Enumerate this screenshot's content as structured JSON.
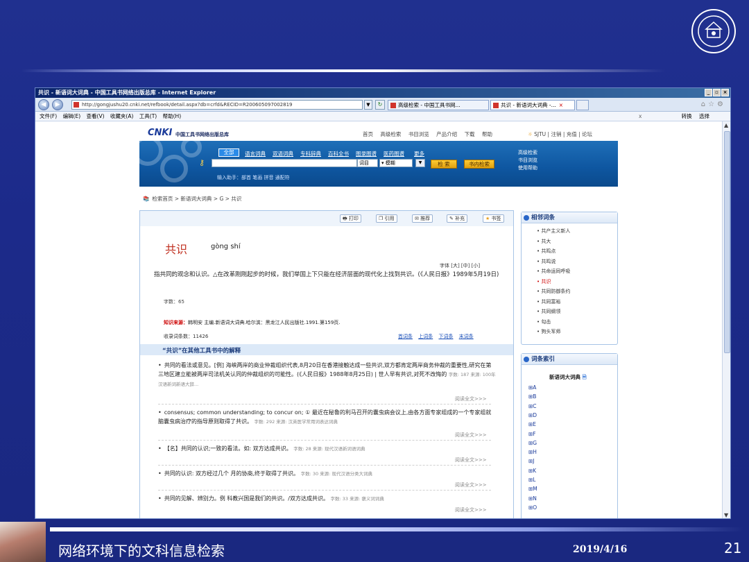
{
  "slide": {
    "footer_title": "网络环境下的文科信息检索",
    "footer_date": "2019/4/16",
    "page_number": "21",
    "logo_icon": "university-seal-icon"
  },
  "browser": {
    "window_title": "共识 - 新语词大词典 - 中国工具书网络出版总库 - Internet Explorer",
    "address": "http://gongjushu20.cnki.net/refbook/detail.aspx?db=crfd&RECID=R200605097002819",
    "tabs": [
      {
        "label": "高级检索 - 中国工具书网..."
      },
      {
        "label": "共识 - 新语词大词典 -...",
        "close": "×"
      }
    ],
    "menu": [
      "文件(F)",
      "编辑(E)",
      "查看(V)",
      "收藏夹(A)",
      "工具(T)",
      "帮助(H)"
    ],
    "menu_right": [
      "转换",
      "选择"
    ],
    "menu_close": "x",
    "window_buttons": [
      "_",
      "▫",
      "×"
    ]
  },
  "cnki": {
    "logo": "CNKI",
    "logo_cn": "中国工具书网络出版总库",
    "topnav": [
      "首页",
      "高级检索",
      "书目浏览",
      "产品介绍",
      "下载",
      "帮助"
    ],
    "user": "SJTU | 注销 | 充值 | 论坛",
    "categories": [
      "全部",
      "语言词典",
      "双语词典",
      "专科辞典",
      "百科全书",
      "图录图谱",
      "医药图谱",
      "更多"
    ],
    "field_select": "词目",
    "mode_select": "模糊",
    "search_button": "检 索",
    "book_search_button": "书内检索",
    "helper": "输入助手：部首 笔画 拼音 通配符",
    "right_links": [
      "高级检索",
      "书目浏览",
      "使用帮助"
    ],
    "breadcrumb": "检索首页 > 新语词大词典 > G > 共识"
  },
  "toolbar": [
    "打印",
    "引用",
    "推荐",
    "补充",
    "书签"
  ],
  "entry": {
    "headword": "共识",
    "pinyin": "gòng shí",
    "font_size": "字体 [大] [中] [小]",
    "definition": "指共同的观念和认识。△在改革刚刚起步的时候，我们举国上下只能在经济层面的现代化上找到共识。(《人民日报》1989年5月19日)",
    "wordcount": "字数：65",
    "source_label": "知识来源：",
    "source_text": "韩明安 主编.新语词大词典.哈尔滨：黑龙江人民出版社.1991.第159页.",
    "entrycount": "收录词条数：11426",
    "nav_links": [
      "首词条",
      "上词条",
      "下词条",
      "末词条"
    ]
  },
  "other": {
    "title": "“共识”在其他工具书中的解释",
    "read_more": "阅读全文>>>",
    "items": [
      {
        "text": "共同的看法或意见。[例] 海峡两岸的商业仲裁组织代表,8月20日在香港接触达成一些共识,双方都肯定两岸商务仲裁的重要性,研究在第三地区建立能被两岸司法机关认同的仲裁组织的可能性。(《人民日报》1988年8月25日) | 世人早有共识,对死不改悔的",
        "meta": "字数: 187  来源: 100年汉语新词新语大辞..."
      },
      {
        "text": "consensus; common understanding; to concur on; ① 最近在秘鲁的利马召开的囊虫病会议上,由各方面专家组成的一个专家组就脑囊虫病治疗的指导原则取得了共识。",
        "meta": "字数: 292  来源: 汉英医学常用词表达词典"
      },
      {
        "text": "【名】共同的认识;一致的看法。如: 双方达成共识。",
        "meta": "字数: 28  来源: 现代汉语新词语词典"
      },
      {
        "text": "共同的认识: 双方经过几个 月的协商,终于取得了共识。",
        "meta": "字数: 30  来源: 现代汉语分类大词典"
      },
      {
        "text": "共同的见解、辨别力。例 科教兴国是我们的共识。/双方达成共识。",
        "meta": "字数: 33  来源: 褒义词词典"
      }
    ]
  },
  "related": {
    "title": "相邻词条",
    "items": [
      "共产主义新人",
      "共大",
      "共鸣点",
      "共鸣说",
      "共命运同呼吸",
      "共识",
      "共同防御条约",
      "共同富裕",
      "共同纲领",
      "勾击",
      "狗头军师"
    ],
    "current_index": 5
  },
  "index": {
    "title": "词条索引",
    "dict": "新语词大词典",
    "letters": [
      "A",
      "B",
      "C",
      "D",
      "E",
      "F",
      "G",
      "H",
      "J",
      "K",
      "L",
      "M",
      "N",
      "O"
    ]
  }
}
